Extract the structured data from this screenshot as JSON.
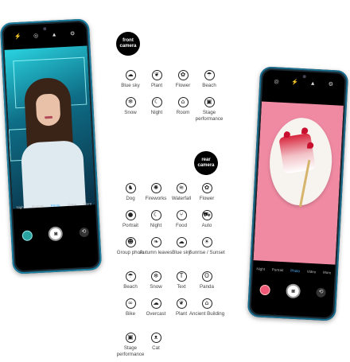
{
  "badges": {
    "front": "front\ncamera",
    "rear": "rear\ncamera"
  },
  "front_scenes": [
    {
      "label": "Blue sky",
      "icon": "blue-sky-icon",
      "glyph": "☁"
    },
    {
      "label": "Plant",
      "icon": "plant-icon",
      "glyph": "❦"
    },
    {
      "label": "Flower",
      "icon": "flower-icon",
      "glyph": "✿"
    },
    {
      "label": "Beach",
      "icon": "beach-icon",
      "glyph": "☂"
    },
    {
      "label": "Snow",
      "icon": "snow-icon",
      "glyph": "❄"
    },
    {
      "label": "Night",
      "icon": "night-icon",
      "glyph": "☾"
    },
    {
      "label": "Room",
      "icon": "room-icon",
      "glyph": "⌂"
    },
    {
      "label": "Stage performance",
      "icon": "stage-icon",
      "glyph": "▣"
    }
  ],
  "rear_scenes": [
    {
      "label": "Dog",
      "icon": "dog-icon",
      "glyph": "♞"
    },
    {
      "label": "Fireworks",
      "icon": "fireworks-icon",
      "glyph": "✺"
    },
    {
      "label": "Waterfall",
      "icon": "waterfall-icon",
      "glyph": "≋"
    },
    {
      "label": "Flower",
      "icon": "flower-icon",
      "glyph": "✿"
    },
    {
      "label": "Portrait",
      "icon": "portrait-icon",
      "glyph": "●"
    },
    {
      "label": "Night",
      "icon": "night-icon",
      "glyph": "☾"
    },
    {
      "label": "Food",
      "icon": "food-icon",
      "glyph": "⑂"
    },
    {
      "label": "Auto",
      "icon": "auto-icon",
      "glyph": "⛟"
    },
    {
      "label": "Group photo",
      "icon": "group-photo-icon",
      "glyph": "☻"
    },
    {
      "label": "Autumn leaves",
      "icon": "autumn-leaves-icon",
      "glyph": "❧"
    },
    {
      "label": "Blue sky",
      "icon": "blue-sky-icon",
      "glyph": "☁"
    },
    {
      "label": "Sunrise / Sunset",
      "icon": "sunrise-icon",
      "glyph": "☀"
    },
    {
      "label": "Beach",
      "icon": "beach-icon",
      "glyph": "☂"
    },
    {
      "label": "Snow",
      "icon": "snow-icon",
      "glyph": "❄"
    },
    {
      "label": "Text",
      "icon": "text-icon",
      "glyph": "T"
    },
    {
      "label": "Panda",
      "icon": "panda-icon",
      "glyph": "ʘ"
    },
    {
      "label": "Bike",
      "icon": "bike-icon",
      "glyph": "∞"
    },
    {
      "label": "Overcast",
      "icon": "overcast-icon",
      "glyph": "☁"
    },
    {
      "label": "Plant",
      "icon": "plant-icon",
      "glyph": "❦"
    },
    {
      "label": "Ancient Building",
      "icon": "ancient-building-icon",
      "glyph": "⌂"
    },
    {
      "label": "Stage performance",
      "icon": "stage-icon",
      "glyph": "▣"
    },
    {
      "label": "Cat",
      "icon": "cat-icon",
      "glyph": "ᴥ"
    }
  ],
  "left_phone": {
    "modes": [
      "Night",
      "Portrait",
      "Photo",
      "Video",
      "More"
    ],
    "active_mode": "Photo"
  },
  "right_phone": {
    "modes": [
      "Night",
      "Portrait",
      "Photo",
      "Video",
      "More"
    ],
    "active_mode": "Photo"
  },
  "colors": {
    "phone_frame": "#1a7fa0",
    "active_mode": "#4db6ff",
    "badge": "#000000",
    "plate_bg": "#f08aa2"
  }
}
